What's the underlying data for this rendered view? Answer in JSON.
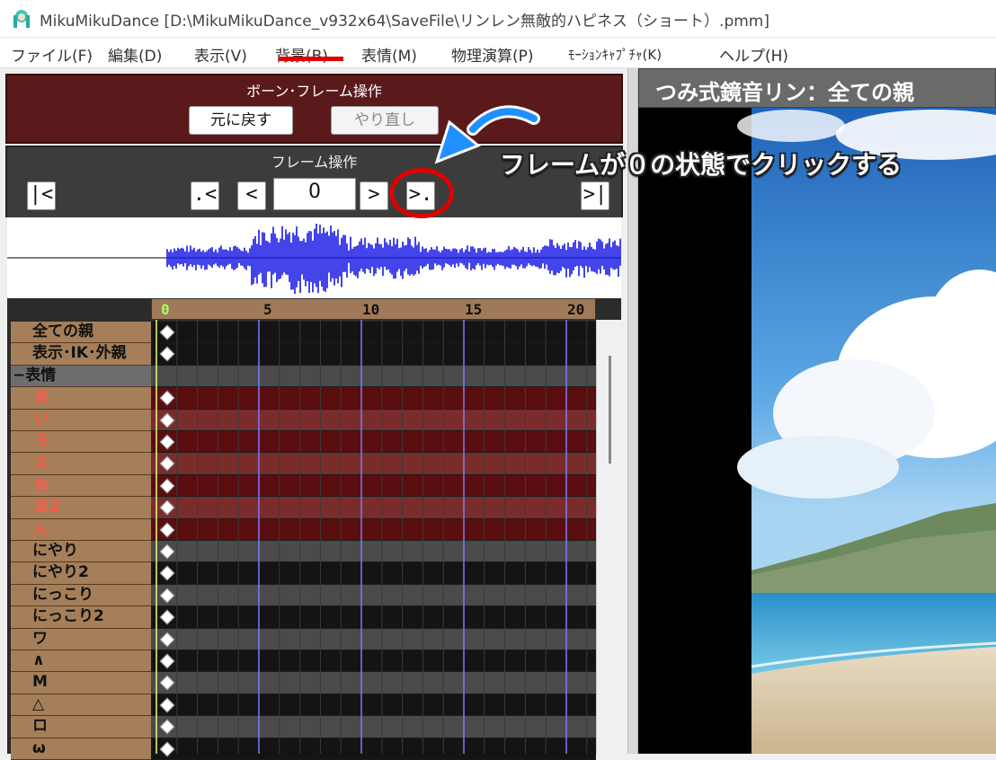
{
  "window": {
    "title": "MikuMikuDance [D:\\MikuMikuDance_v932x64\\SaveFile\\リンレン無敵的ハピネス（ショート）.pmm]"
  },
  "menu": {
    "items": [
      "ファイル(F)",
      "編集(D)",
      "表示(V)",
      "背景(B)",
      "表情(M)",
      "物理演算(P)",
      "ﾓｰｼｮﾝｷｬﾌﾟﾁｬ(K)",
      "ヘルプ(H)"
    ]
  },
  "bone_panel": {
    "title": "ボーン･フレーム操作",
    "undo_label": "元に戻す",
    "redo_label": "やり直し"
  },
  "frame_panel": {
    "title": "フレーム操作",
    "first_label": "|<",
    "prev_key_label": ".<",
    "prev_label": "<",
    "frame_value": "0",
    "next_label": ">",
    "next_key_label": ">.",
    "last_label": ">|"
  },
  "timeline": {
    "ticks": [
      "0",
      "5",
      "10",
      "15",
      "20"
    ],
    "rows": [
      {
        "label": "全ての親",
        "kind": "bone",
        "track": "dark"
      },
      {
        "label": "表示･IK･外親",
        "kind": "bone",
        "track": "dark"
      },
      {
        "label": "−表情",
        "kind": "group",
        "track": "mid"
      },
      {
        "label": "あ",
        "kind": "morph",
        "track": "red1"
      },
      {
        "label": "い",
        "kind": "morph",
        "track": "red2"
      },
      {
        "label": "う",
        "kind": "morph",
        "track": "red1"
      },
      {
        "label": "え",
        "kind": "morph",
        "track": "red2"
      },
      {
        "label": "お",
        "kind": "morph",
        "track": "red1"
      },
      {
        "label": "あ2",
        "kind": "morph",
        "track": "red2"
      },
      {
        "label": "ん",
        "kind": "morph",
        "track": "red1"
      },
      {
        "label": "にやり",
        "kind": "bone",
        "track": "mid"
      },
      {
        "label": "にやり2",
        "kind": "bone",
        "track": "dark"
      },
      {
        "label": "にっこり",
        "kind": "bone",
        "track": "mid"
      },
      {
        "label": "にっこり2",
        "kind": "bone",
        "track": "dark"
      },
      {
        "label": "ワ",
        "kind": "bone",
        "track": "mid"
      },
      {
        "label": "∧",
        "kind": "bone",
        "track": "dark"
      },
      {
        "label": "M",
        "kind": "bone",
        "track": "mid"
      },
      {
        "label": "△",
        "kind": "bone",
        "track": "dark"
      },
      {
        "label": "ロ",
        "kind": "bone",
        "track": "mid"
      },
      {
        "label": "ω",
        "kind": "bone",
        "track": "dark"
      }
    ]
  },
  "viewport": {
    "title": "つみ式鏡音リン：全ての親"
  },
  "annotation": {
    "text": "フレームが０の状態でクリックする"
  },
  "colors": {
    "accent_red": "#e00000",
    "arrow_blue": "#1e90ff",
    "waveform": "#1515e6",
    "panel_maroon": "#5a1a1c"
  }
}
